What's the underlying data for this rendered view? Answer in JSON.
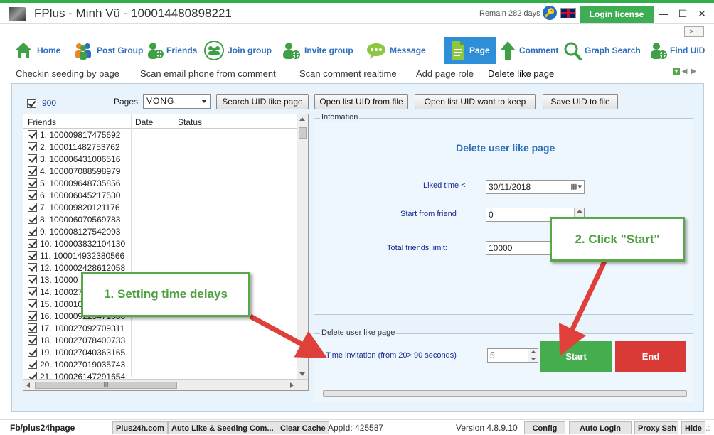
{
  "window": {
    "title": "FPlus - Minh Vũ - 100014480898221",
    "remain": "Remain 282 days",
    "login_label": "Login license",
    "minimize": "—",
    "maximize": "☐",
    "close": "✕",
    "more": ">..."
  },
  "nav": [
    {
      "label": "Home",
      "icon": "home-icon"
    },
    {
      "label": "Post Group",
      "icon": "post-group-icon"
    },
    {
      "label": "Friends",
      "icon": "friends-icon"
    },
    {
      "label": "Join group",
      "icon": "join-group-icon"
    },
    {
      "label": "Invite group",
      "icon": "invite-group-icon"
    },
    {
      "label": "Message",
      "icon": "message-icon"
    },
    {
      "label": "Page",
      "icon": "page-icon"
    },
    {
      "label": "Comment",
      "icon": "comment-icon"
    },
    {
      "label": "Graph Search",
      "icon": "search-icon"
    },
    {
      "label": "Find UID",
      "icon": "find-uid-icon"
    }
  ],
  "tabs": [
    "Checkin seeding by page",
    "Scan email phone from comment",
    "Scan comment realtime",
    "Add page role",
    "Delete like page"
  ],
  "toolbar": {
    "count": "900",
    "pages_label": "Pages",
    "pages_value": "VỌNG",
    "search_btn": "Search UID like page",
    "open_list_btn": "Open list UID from file",
    "open_keep_btn": "Open list UID want to keep",
    "save_btn": "Save UID to file"
  },
  "list": {
    "columns": [
      "Friends",
      "Date",
      "Status"
    ],
    "rows": [
      "1. 100009817475692",
      "2. 100011482753762",
      "3. 100006431006516",
      "4. 100007088598979",
      "5. 100009648735856",
      "6. 100006045217530",
      "7. 100009820121176",
      "8. 100006070569783",
      "9. 100008127542093",
      "10. 100003832104130",
      "11. 100014932380566",
      "12. 100002428612058",
      "13. 10000",
      "14. 100027",
      "15. 100010",
      "16. 100009225471080",
      "17. 100027092709311",
      "18. 100027078400733",
      "19. 100027040363165",
      "20. 100027019035743",
      "21. 100026147291654"
    ],
    "hscroll_thumb": "III"
  },
  "info": {
    "title": "Infomation",
    "heading": "Delete user like page",
    "liked_time_label": "Liked time <",
    "liked_time_value": "30/11/2018",
    "start_from_label": "Start from friend",
    "start_from_value": "0",
    "total_limit_label": "Total friends limit:",
    "total_limit_value": "10000"
  },
  "delete": {
    "title": "Delete user like page",
    "time_label": "Time invitation (from 20> 90 seconds)",
    "time_value": "5",
    "start_btn": "Start",
    "end_btn": "End"
  },
  "callouts": {
    "one": "1. Setting time delays",
    "two": "2. Click \"Start\""
  },
  "status": {
    "page": "Fb/plus24hpage",
    "site": "Plus24h.com",
    "auto_like": "Auto Like & Seeding Com...",
    "clear_cache": "Clear Cache",
    "app_id": "AppId: 425587",
    "version": "Version 4.8.9.10",
    "config": "Config",
    "auto_login": "Auto Login",
    "proxy": "Proxy Ssh",
    "hide": "Hide",
    "grip": ".:"
  },
  "colors": {
    "accent": "#2e6fbe",
    "green": "#46ad4f",
    "red": "#d93a36",
    "callout_border": "#5aa64a",
    "arrow": "#e0403a"
  }
}
